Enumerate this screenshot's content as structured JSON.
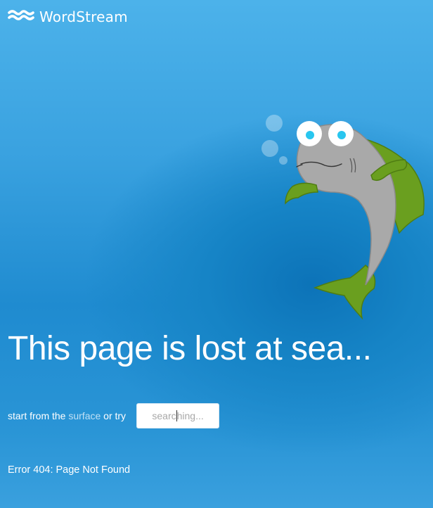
{
  "brand": {
    "name": "WordStream",
    "logo_icon": "waves-icon"
  },
  "illustration": {
    "subject": "fish-icon",
    "bubbles_icon": "bubbles-icon",
    "colors": {
      "body": "#a9a9a9",
      "fins": "#6a9f1f",
      "eyes": "#29c6ef"
    }
  },
  "main": {
    "headline": "This page is lost at sea...",
    "help": {
      "prefix": "start from the",
      "link_label": "surface",
      "suffix": "or try"
    },
    "search": {
      "value_before_caret": "searc",
      "value_after_caret": "hing..."
    },
    "error_message": "Error 404: Page Not Found"
  },
  "colors": {
    "background_top": "#4cb2ea",
    "background_deep": "#0c73b8",
    "text": "#ffffff",
    "link": "#bfe0f5"
  }
}
